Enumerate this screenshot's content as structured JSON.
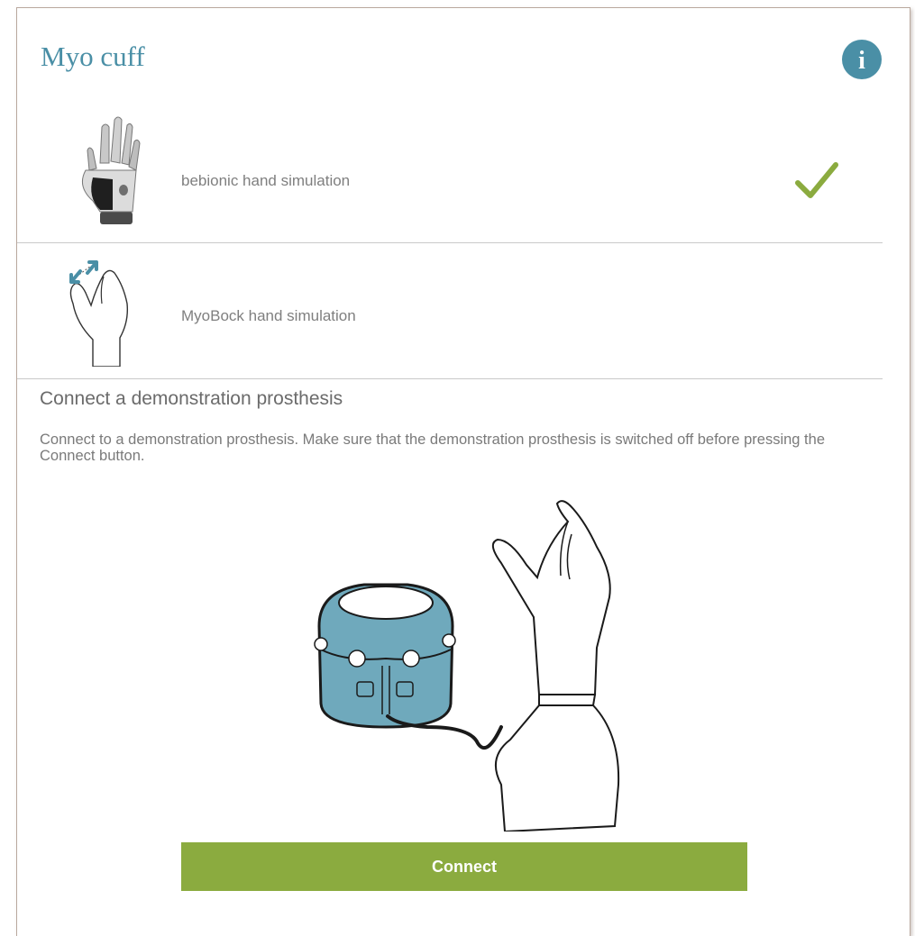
{
  "header": {
    "title": "Myo cuff",
    "info_icon": "info-icon"
  },
  "simulations": [
    {
      "label": "bebionic hand simulation",
      "icon": "bebionic-hand-icon",
      "selected": true
    },
    {
      "label": "MyoBock hand simulation",
      "icon": "myobock-hand-icon",
      "selected": false
    }
  ],
  "connect_section": {
    "title": "Connect a demonstration prosthesis",
    "description": "Connect to a demonstration prosthesis. Make sure that the demonstration prosthesis is switched off before pressing the Connect button.",
    "button_label": "Connect"
  },
  "colors": {
    "accent_teal": "#4a8fa6",
    "check_green": "#8bab3f",
    "button_green": "#8bab3f",
    "cuff_blue": "#6fa9bc"
  }
}
